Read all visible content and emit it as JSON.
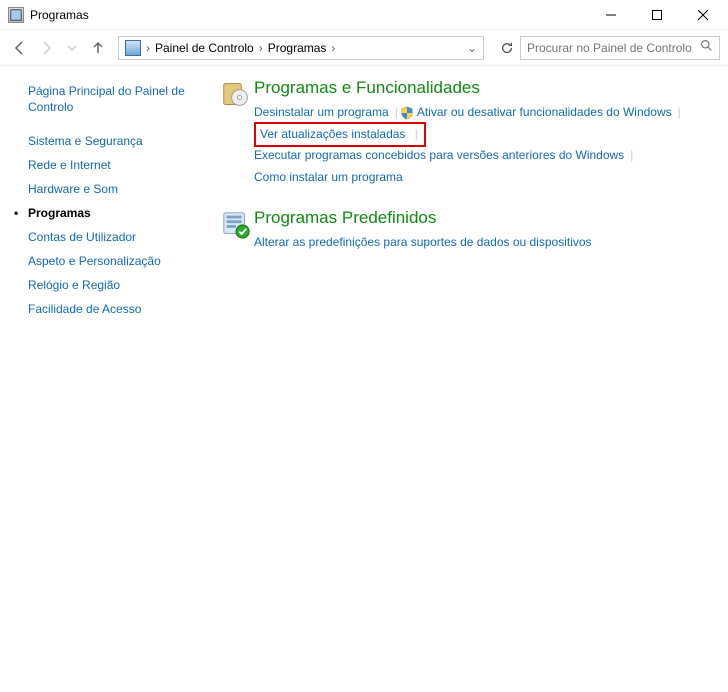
{
  "titlebar": {
    "title": "Programas"
  },
  "breadcrumb": {
    "crumb1": "Painel de Controlo",
    "crumb2": "Programas"
  },
  "search": {
    "placeholder": "Procurar no Painel de Controlo"
  },
  "sidebar": {
    "home": "Página Principal do Painel de Controlo",
    "items": {
      "0": "Sistema e Segurança",
      "1": "Rede e Internet",
      "2": "Hardware e Som",
      "3": "Programas",
      "4": "Contas de Utilizador",
      "5": "Aspeto e Personalização",
      "6": "Relógio e Região",
      "7": "Facilidade de Acesso"
    }
  },
  "section1": {
    "title": "Programas e Funcionalidades",
    "links": {
      "uninstall": "Desinstalar um programa",
      "features": "Ativar ou desativar funcionalidades do Windows",
      "updates": "Ver atualizações instaladas",
      "compat": "Executar programas concebidos para versões anteriores do Windows",
      "howto": "Como instalar um programa"
    }
  },
  "section2": {
    "title": "Programas Predefinidos",
    "links": {
      "defaults": "Alterar as predefinições para suportes de dados ou dispositivos"
    }
  }
}
